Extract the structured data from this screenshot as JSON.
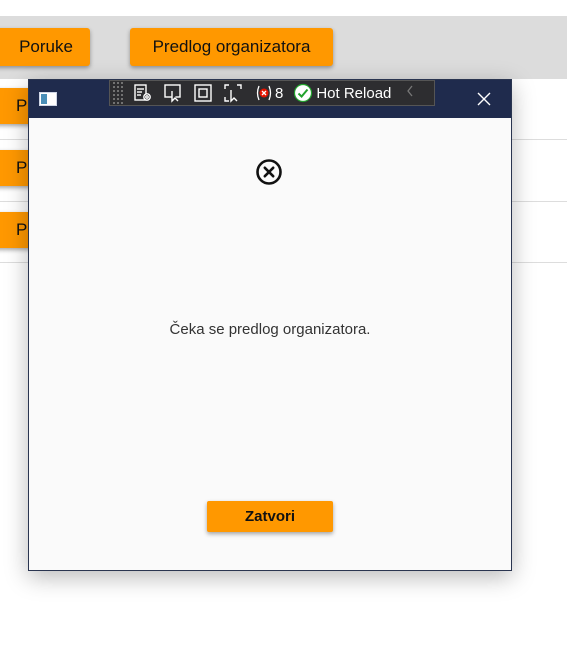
{
  "background": {
    "nav_buttons": [
      {
        "label": "Poruke"
      },
      {
        "label": "Predlog organizatora"
      }
    ],
    "list_buttons": [
      {
        "label": "P"
      },
      {
        "label": "P"
      },
      {
        "label": "P"
      }
    ]
  },
  "dialog": {
    "devtools": {
      "error_count": "8",
      "hot_reload_label": "Hot Reload"
    },
    "message": "Čeka se predlog organizatora.",
    "close_label": "Zatvori"
  },
  "colors": {
    "accent": "#ff9800",
    "titlebar": "#1f2b4d",
    "dialog_bg": "#fafafa",
    "top_bar": "#dcdcdc"
  },
  "icons": {
    "status": "circle-x-icon",
    "window_close": "close-icon",
    "app": "app-icon",
    "hot_reload": "check-circle-icon"
  }
}
